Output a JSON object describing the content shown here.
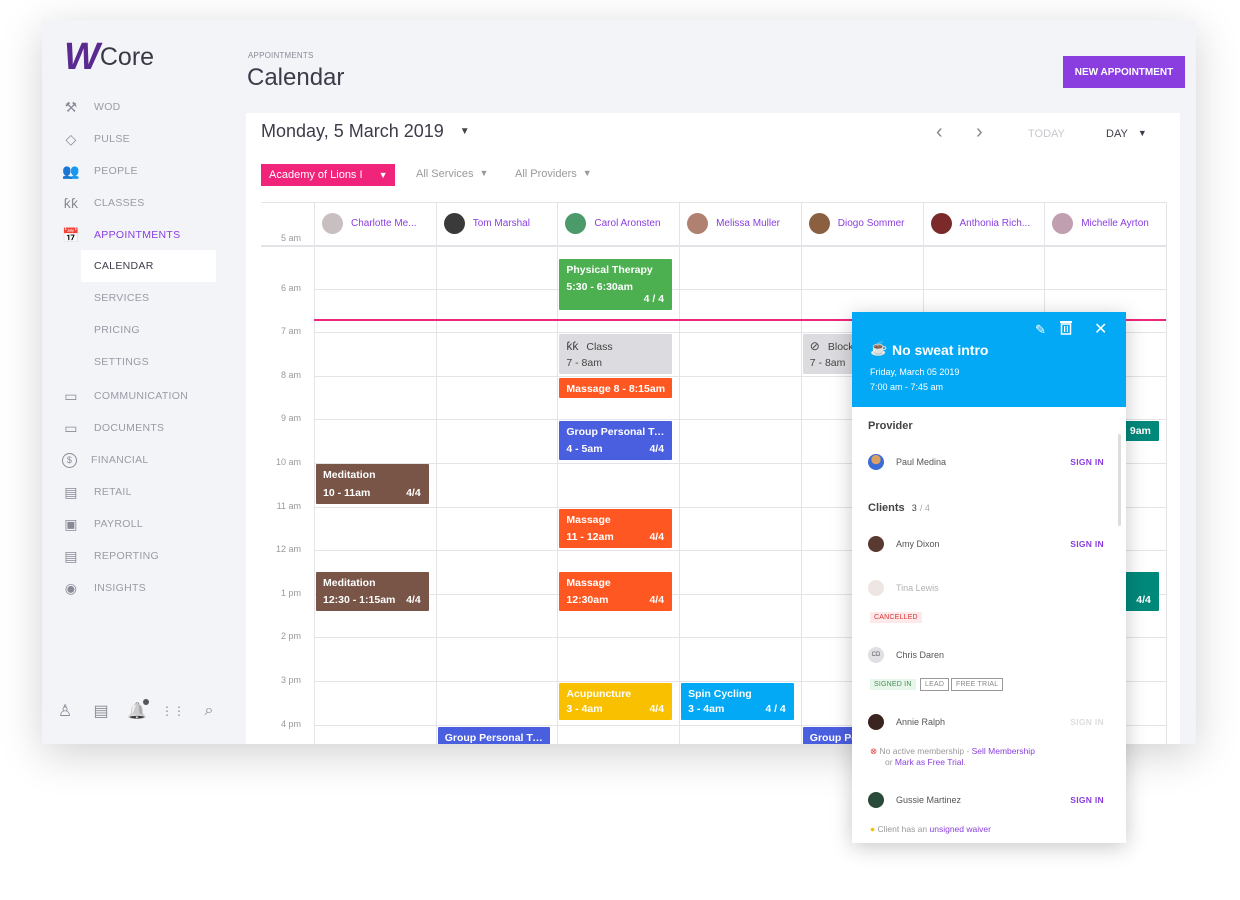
{
  "app": {
    "logo_mark": "W",
    "logo_text": "Core",
    "brand_color": "#5b2a8e",
    "accent": "#8a3ee0"
  },
  "sidebar": {
    "items": [
      {
        "label": "WOD",
        "icon": "barbell-icon"
      },
      {
        "label": "PULSE",
        "icon": "pulse-icon"
      },
      {
        "label": "PEOPLE",
        "icon": "people-icon"
      },
      {
        "label": "CLASSES",
        "icon": "classes-icon"
      },
      {
        "label": "APPOINTMENTS",
        "icon": "calendar-icon",
        "active": true
      },
      {
        "label": "COMMUNICATION",
        "icon": "chat-icon"
      },
      {
        "label": "DOCUMENTS",
        "icon": "folder-icon"
      },
      {
        "label": "FINANCIAL",
        "icon": "dollar-icon"
      },
      {
        "label": "RETAIL",
        "icon": "cart-icon"
      },
      {
        "label": "PAYROLL",
        "icon": "payroll-icon"
      },
      {
        "label": "REPORTING",
        "icon": "clipboard-icon"
      },
      {
        "label": "INSIGHTS",
        "icon": "eye-icon"
      }
    ],
    "subitems": [
      {
        "label": "CALENDAR",
        "active": true
      },
      {
        "label": "SERVICES"
      },
      {
        "label": "PRICING"
      },
      {
        "label": "SETTINGS"
      }
    ],
    "bottom_icons": [
      "user-icon",
      "clipboard-icon",
      "bell-icon",
      "apps-grid-icon",
      "search-icon"
    ]
  },
  "header": {
    "breadcrumb": "APPOINTMENTS",
    "title": "Calendar",
    "new_button": "NEW APPOINTMENT"
  },
  "toolbar": {
    "date": "Monday, 5 March 2019",
    "today": "TODAY",
    "view": "DAY",
    "location": "Academy of Lions I",
    "services": "All Services",
    "providers": "All Providers"
  },
  "providers": [
    "Charlotte Me...",
    "Tom Marshal",
    "Carol Aronsten",
    "Melissa Muller",
    "Diogo Sommer",
    "Anthonia Rich...",
    "Michelle Ayrton"
  ],
  "hours": [
    "5 am",
    "6 am",
    "7 am",
    "8 am",
    "9 am",
    "10 am",
    "11 am",
    "12 am",
    "1 pm",
    "2 pm",
    "3 pm",
    "4 pm"
  ],
  "now_hour": 6.7,
  "events": [
    {
      "col": 2,
      "start": 5.32,
      "end": 6.5,
      "title": "Physical Therapy",
      "time": "5:30 - 6:30am",
      "count": "4 / 4",
      "color": "#4caf50",
      "layout": "three"
    },
    {
      "col": 2,
      "start": 7.05,
      "end": 7.95,
      "title": "Class",
      "time": "7 - 8am",
      "count": "",
      "color": "#dcdce0",
      "dark": true,
      "icon": "classes-icon"
    },
    {
      "col": 4,
      "start": 7.05,
      "end": 7.95,
      "title": "Block",
      "time": "7 - 8am",
      "count": "",
      "color": "#dcdce0",
      "dark": true,
      "icon": "ban-icon"
    },
    {
      "col": 2,
      "start": 8.05,
      "end": 8.5,
      "title": "Massage   8 - 8:15am",
      "time": "",
      "count": "",
      "color": "#ff5722"
    },
    {
      "col": 2,
      "start": 9.03,
      "end": 9.93,
      "title": "Group Personal Tr...",
      "time": "4 - 5am",
      "count": "4/4",
      "color": "#4a5ee0"
    },
    {
      "col": 6,
      "start": 9.03,
      "end": 9.5,
      "title": "",
      "time": "9am",
      "count": "",
      "color": "#00897b",
      "right": true
    },
    {
      "col": 0,
      "start": 10.02,
      "end": 10.95,
      "title": "Meditation",
      "time": "10 - 11am",
      "count": "4/4",
      "color": "#795548"
    },
    {
      "col": 2,
      "start": 11.05,
      "end": 11.95,
      "title": "Massage",
      "time": "11 - 12am",
      "count": "4/4",
      "color": "#ff5722"
    },
    {
      "col": 0,
      "start": 12.5,
      "end": 13.4,
      "title": "Meditation",
      "time": "12:30 - 1:15am",
      "count": "4/4",
      "color": "#795548"
    },
    {
      "col": 2,
      "start": 12.5,
      "end": 13.4,
      "title": "Massage",
      "time": "12:30am",
      "count": "4/4",
      "color": "#ff5722"
    },
    {
      "col": 6,
      "start": 12.5,
      "end": 13.4,
      "title": "",
      "time": "",
      "count": "4/4",
      "color": "#00897b"
    },
    {
      "col": 2,
      "start": 15.05,
      "end": 15.9,
      "title": "Acupuncture",
      "time": "3 - 4am",
      "count": "4/4",
      "color": "#f9c000"
    },
    {
      "col": 3,
      "start": 15.05,
      "end": 15.9,
      "title": "Spin Cycling",
      "time": "3 - 4am",
      "count": "4 / 4",
      "color": "#03a9f4"
    },
    {
      "col": 1,
      "start": 16.05,
      "end": 17,
      "title": "Group Personal Tr...",
      "time": "",
      "count": "",
      "color": "#4a5ee0"
    },
    {
      "col": 4,
      "start": 16.05,
      "end": 17,
      "title": "Group Personal Tr...",
      "time": "",
      "count": "",
      "color": "#4a5ee0"
    }
  ],
  "popup": {
    "title": "No sweat intro",
    "date": "Friday, March 05 2019",
    "time": "7:00 am - 7:45 am",
    "color": "#03a9f4",
    "provider_label": "Provider",
    "provider": "Paul Medina",
    "sign_in": "SIGN IN",
    "clients_label": "Clients",
    "clients_count": "3",
    "clients_total": "/ 4",
    "clients": [
      {
        "name": "Amy Dixon",
        "sign": "SIGN IN"
      },
      {
        "name": "Tina Lewis",
        "tag": "CANCELLED"
      },
      {
        "name": "Chris Daren",
        "initials": "CD",
        "tags": [
          "SIGNED IN",
          "LEAD",
          "FREE TRIAL"
        ]
      },
      {
        "name": "Annie Ralph",
        "sign": "SIGN IN",
        "note_pre": "No active membership - ",
        "note_link1": "Sell Membership",
        "note_mid": "or ",
        "note_link2": "Mark as Free Trial",
        "note_end": "."
      },
      {
        "name": "Gussie Martinez",
        "sign": "SIGN IN",
        "note_pre": "Client has an ",
        "note_link1": "unsigned waiver"
      }
    ]
  }
}
